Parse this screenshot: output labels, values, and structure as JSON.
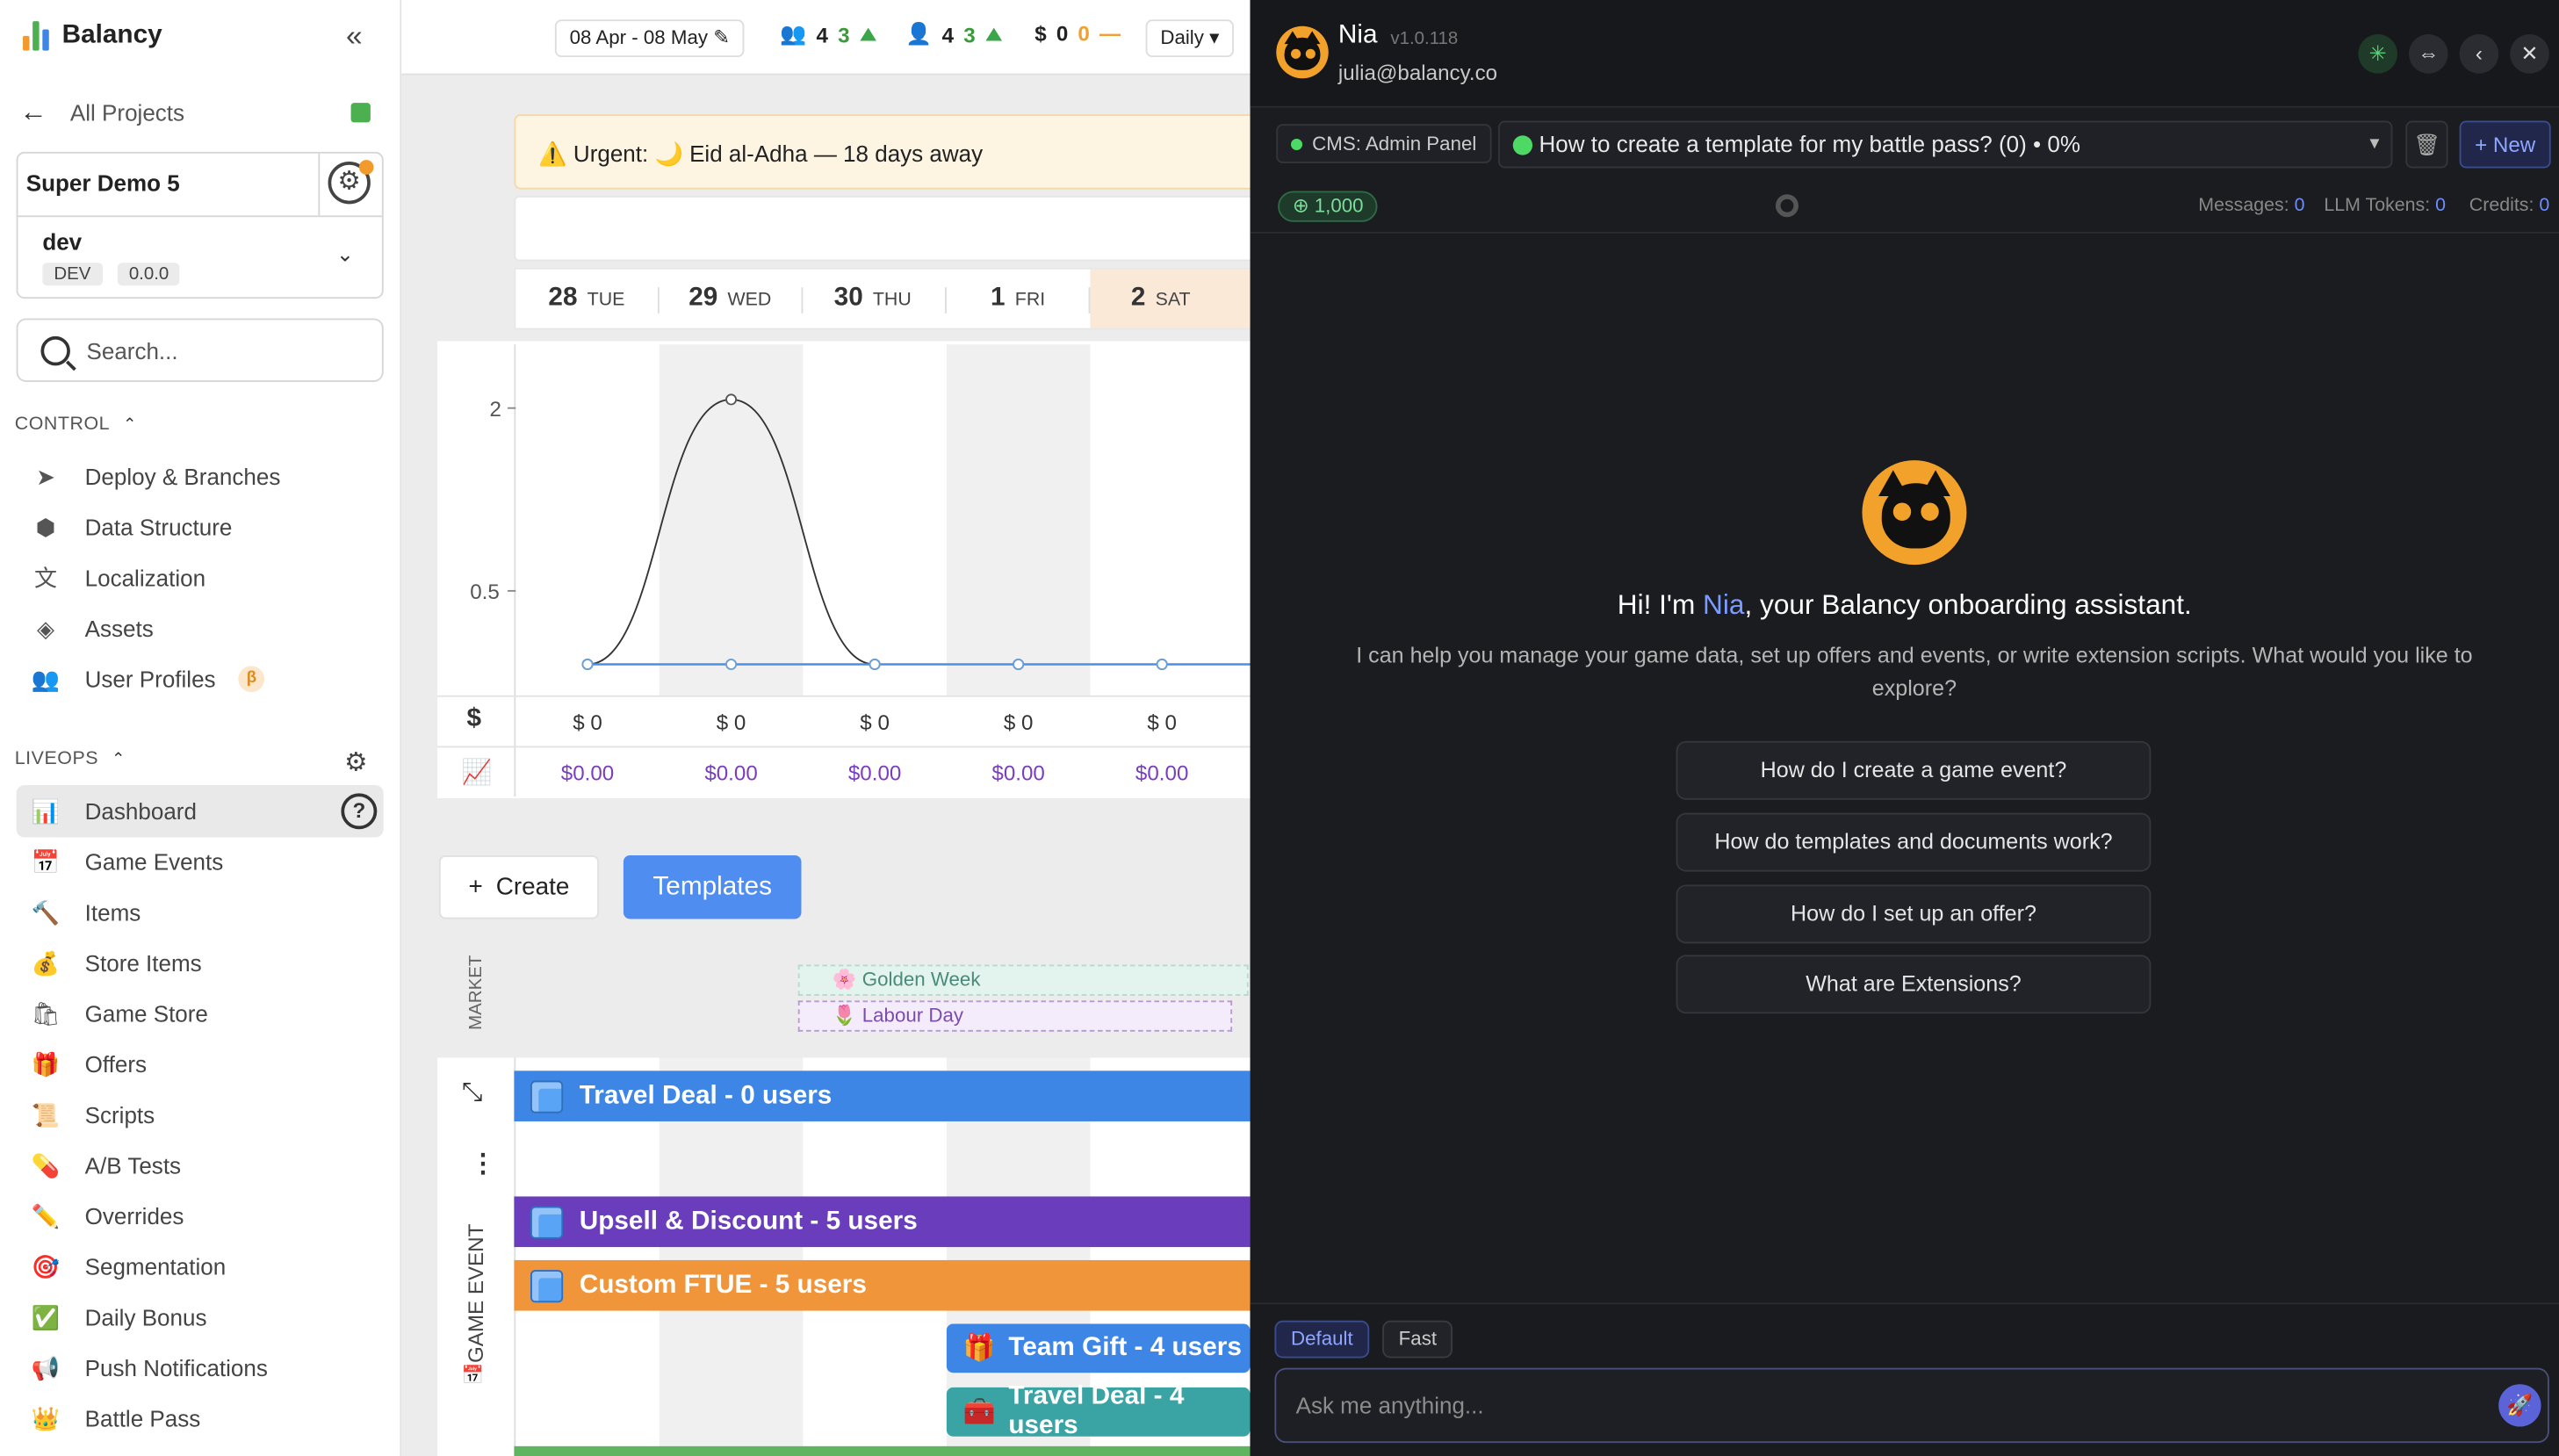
{
  "app": {
    "name": "Balancy",
    "all_projects": "All Projects"
  },
  "project": {
    "name": "Super Demo 5",
    "branch": "dev",
    "env_tag": "DEV",
    "version": "0.0.0"
  },
  "search": {
    "placeholder": "Search..."
  },
  "sections": {
    "control": {
      "label": "CONTROL",
      "items": [
        {
          "label": "Deploy & Branches",
          "icon": "paper-plane-icon"
        },
        {
          "label": "Data Structure",
          "icon": "cube-icon"
        },
        {
          "label": "Localization",
          "icon": "translate-icon"
        },
        {
          "label": "Assets",
          "icon": "layers-icon"
        },
        {
          "label": "User Profiles",
          "icon": "users-icon",
          "badge": "β"
        }
      ]
    },
    "liveops": {
      "label": "LIVEOPS",
      "items": [
        {
          "label": "Dashboard",
          "icon": "📊"
        },
        {
          "label": "Game Events",
          "icon": "📅"
        },
        {
          "label": "Items",
          "icon": "🔨"
        },
        {
          "label": "Store Items",
          "icon": "💰"
        },
        {
          "label": "Game Store",
          "icon": "🛍"
        },
        {
          "label": "Offers",
          "icon": "🎁"
        },
        {
          "label": "Scripts",
          "icon": "📜"
        },
        {
          "label": "A/B Tests",
          "icon": "💊"
        },
        {
          "label": "Overrides",
          "icon": "✏️"
        },
        {
          "label": "Segmentation",
          "icon": "🎯"
        },
        {
          "label": "Daily Bonus",
          "icon": "✅"
        },
        {
          "label": "Push Notifications",
          "icon": "📢"
        },
        {
          "label": "Battle Pass",
          "icon": "👑"
        }
      ]
    }
  },
  "topbar": {
    "date_range": "08 Apr - 08 May",
    "users": {
      "value": "4",
      "delta": "3"
    },
    "new_users": {
      "value": "4",
      "delta": "3"
    },
    "revenue": {
      "value": "0",
      "delta": "0",
      "trend": "—"
    },
    "granularity": "Daily"
  },
  "urgent": {
    "text": "⚠️ Urgent: 🌙 Eid al-Adha — 18 days away"
  },
  "days": [
    {
      "num": "28",
      "dow": "TUE"
    },
    {
      "num": "29",
      "dow": "WED"
    },
    {
      "num": "30",
      "dow": "THU"
    },
    {
      "num": "1",
      "dow": "FRI"
    },
    {
      "num": "2",
      "dow": "SAT"
    }
  ],
  "chart_data": {
    "type": "line",
    "x": [
      "28 TUE",
      "29 WED",
      "30 THU",
      "1 FRI",
      "2 SAT"
    ],
    "series": [
      {
        "values": [
          0,
          2.2,
          0,
          0,
          0
        ],
        "color": "#333333"
      },
      {
        "values": [
          0,
          0,
          0,
          0,
          0
        ],
        "color": "#4a90e2"
      }
    ],
    "ytick_labels": [
      "2",
      "0.5"
    ],
    "ylim": [
      0,
      2.4
    ]
  },
  "rows": {
    "dollar_label": "$",
    "dollar_values": [
      "$ 0",
      "$ 0",
      "$ 0",
      "$ 0",
      "$ 0"
    ],
    "arpu_values": [
      "$0.00",
      "$0.00",
      "$0.00",
      "$0.00",
      "$0.00"
    ]
  },
  "buttons": {
    "create": "Create",
    "templates": "Templates"
  },
  "market": {
    "label": "MARKET",
    "events": [
      "🌸 Golden Week",
      "🌷 Labour Day"
    ]
  },
  "game_events": {
    "label": "GAME EVENT",
    "bars": [
      {
        "label": "Travel Deal - 0 users",
        "color": "#3d86e6"
      },
      {
        "label": "Upsell & Discount - 5 users",
        "color": "#6a3dbd"
      },
      {
        "label": "Custom FTUE - 5 users",
        "color": "#f0953a"
      }
    ],
    "small_bars": [
      {
        "label": "Team Gift - 4 users",
        "color": "#3d86e6",
        "icon": "🎁"
      },
      {
        "label": "Travel Deal - 4 users",
        "color": "#3aa3a3",
        "icon": "🧰"
      }
    ]
  },
  "assistant": {
    "name": "Nia",
    "version": "v1.0.118",
    "email": "julia@balancy.co",
    "context": "CMS: Admin Panel",
    "conversation": "How to create a template for my battle pass? (0) • 0%",
    "new_label": "+ New",
    "credits": "1,000",
    "messages_label": "Messages:",
    "messages": "0",
    "tokens_label": "LLM Tokens:",
    "tokens": "0",
    "credits_label": "Credits:",
    "credits_used": "0",
    "greeting_pre": "Hi! I'm ",
    "greeting_name": "Nia",
    "greeting_post": ", your Balancy onboarding assistant.",
    "intro": "I can help you manage your game data, set up offers and events, or write extension scripts. What would you like to explore?",
    "suggestions": [
      "How do I create a game event?",
      "How do templates and documents work?",
      "How do I set up an offer?",
      "What are Extensions?"
    ],
    "mode_default": "Default",
    "mode_fast": "Fast",
    "input_placeholder": "Ask me anything..."
  }
}
